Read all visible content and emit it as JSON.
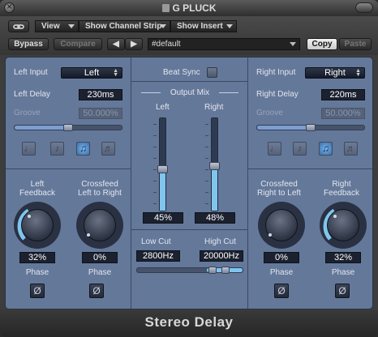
{
  "window": {
    "title": "G PLUCK"
  },
  "header": {
    "link_icon": "link-icon",
    "view_label": "View",
    "show_channel_strip_label": "Show Channel Strip",
    "show_insert_label": "Show Insert",
    "bypass_label": "Bypass",
    "compare_label": "Compare",
    "prev_label": "◀",
    "next_label": "▶",
    "preset_value": "#default",
    "copy_label": "Copy",
    "paste_label": "Paste"
  },
  "left": {
    "input_label": "Left Input",
    "input_value": "Left",
    "delay_label": "Left Delay",
    "delay_value": "230ms",
    "groove_label": "Groove",
    "groove_value": "50.000%",
    "groove_fraction": 0.5,
    "feedback_label_1": "Left",
    "feedback_label_2": "Feedback",
    "feedback_value": "32%",
    "crossfeed_label_1": "Crossfeed",
    "crossfeed_label_2": "Left to Right",
    "crossfeed_value": "0%",
    "phase_label_1": "Phase",
    "phase_label_2": "Phase",
    "phase_symbol": "Ø"
  },
  "center": {
    "beat_sync_label": "Beat Sync",
    "output_mix_label": "Output Mix",
    "left_label": "Left",
    "right_label": "Right",
    "left_mix_value": "45%",
    "right_mix_value": "48%",
    "low_cut_label": "Low Cut",
    "high_cut_label": "High Cut",
    "low_cut_value": "2800Hz",
    "high_cut_value": "20000Hz"
  },
  "right": {
    "input_label": "Right Input",
    "input_value": "Right",
    "delay_label": "Right Delay",
    "delay_value": "220ms",
    "groove_label": "Groove",
    "groove_value": "50.000%",
    "groove_fraction": 0.5,
    "crossfeed_label_1": "Crossfeed",
    "crossfeed_label_2": "Right to Left",
    "crossfeed_value": "0%",
    "feedback_label_1": "Right",
    "feedback_label_2": "Feedback",
    "feedback_value": "32%",
    "phase_label_1": "Phase",
    "phase_label_2": "Phase",
    "phase_symbol": "Ø"
  },
  "note_symbols": [
    "♩",
    "♪",
    "♫",
    "♬"
  ],
  "footer": {
    "plugin_name": "Stereo Delay"
  },
  "colors": {
    "panel": "#64789a",
    "accent": "#7fc5ee",
    "active_note": "#76b4f0"
  }
}
